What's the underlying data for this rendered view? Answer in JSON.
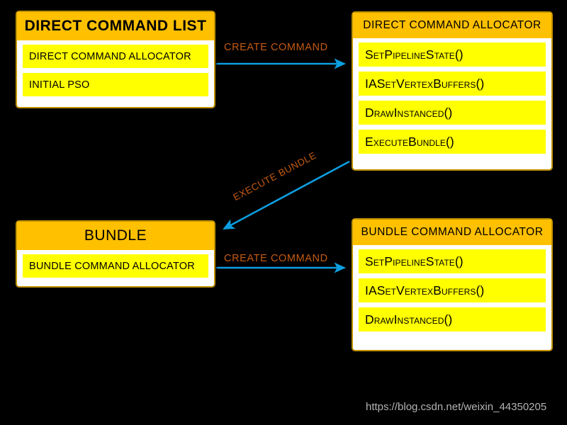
{
  "colors": {
    "background": "#000000",
    "box_border": "#BF9000",
    "box_header_fill": "#FFC000",
    "box_row_fill": "#FFFF00",
    "box_body_fill": "#FFFFFF",
    "arrow": "#0C9EE0",
    "arrow_label_text": "#C55A11",
    "watermark_text": "#B4B4B4"
  },
  "boxes": {
    "direct_command_list": {
      "title": "DIRECT COMMAND LIST",
      "rows": [
        "DIRECT COMMAND ALLOCATOR",
        "INITIAL PSO"
      ]
    },
    "direct_command_allocator": {
      "title": "DIRECT COMMAND ALLOCATOR",
      "rows": [
        "SetPipelineState()",
        "IASetVertexBuffers()",
        "DrawInstanced()",
        "ExecuteBundle()"
      ]
    },
    "bundle": {
      "title": "BUNDLE",
      "rows": [
        "BUNDLE COMMAND ALLOCATOR"
      ]
    },
    "bundle_command_allocator": {
      "title": "BUNDLE COMMAND ALLOCATOR",
      "rows": [
        "SetPipelineState()",
        "IASetVertexBuffers()",
        "DrawInstanced()"
      ]
    }
  },
  "arrows": {
    "create_command_top": {
      "label": "CREATE COMMAND",
      "from": "direct_command_list",
      "to": "direct_command_allocator",
      "direction": "right"
    },
    "execute_bundle": {
      "label": "EXECUTE BUNDLE",
      "from": "direct_command_allocator",
      "to": "bundle",
      "direction": "down-left"
    },
    "create_command_bottom": {
      "label": "CREATE COMMAND",
      "from": "bundle",
      "to": "bundle_command_allocator",
      "direction": "right"
    }
  },
  "watermark": {
    "text": "https://blog.csdn.net/weixin_44350205"
  }
}
